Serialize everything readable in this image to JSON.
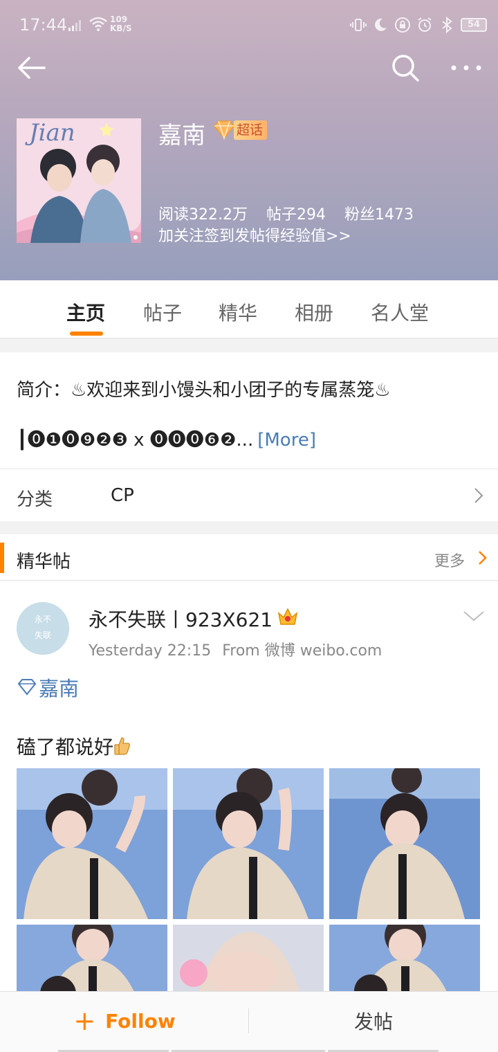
{
  "status_bar": {
    "time": "17:44",
    "net_speed_value": "109",
    "net_speed_unit": "KB/S",
    "battery": "54"
  },
  "topic": {
    "name": "嘉南",
    "badge": "超话",
    "stats": [
      "阅读322.2万",
      "帖子294",
      "粉丝1473"
    ],
    "hint": "加关注签到发帖得经验值>>"
  },
  "tabs": [
    {
      "label": "主页",
      "active": true
    },
    {
      "label": "帖子",
      "active": false
    },
    {
      "label": "精华",
      "active": false
    },
    {
      "label": "相册",
      "active": false
    },
    {
      "label": "名人堂",
      "active": false
    }
  ],
  "intro": {
    "line1": "简介：♨欢迎来到小馒头和小团子的专属蒸笼♨",
    "line2": "┃⓿❶⓿❾❷❸ x ⓿⓿⓿❻❷...",
    "more_label": "[More]",
    "category_label": "分类",
    "category_value": "CP"
  },
  "featured": {
    "title": "精华帖",
    "more_label": "更多"
  },
  "post": {
    "author": "永不失联丨923X621",
    "time": "Yesterday 22:15",
    "source": "From 微博 weibo.com",
    "topic_tag": "嘉南",
    "text": "磕了都说好",
    "avatar_text": "永不失联"
  },
  "bottom": {
    "follow_label": "Follow",
    "post_label": "发帖"
  },
  "colors": {
    "accent": "#ff8200",
    "link": "#4a7cb5",
    "header_top": "#c9b3c2",
    "header_bottom": "#979fbc"
  },
  "icons": [
    "back-arrow-icon",
    "search-icon",
    "more-icon",
    "gem-icon",
    "chevron-right-icon",
    "crown-icon",
    "chevron-down-icon",
    "thumbs-up-icon",
    "plus-icon"
  ]
}
